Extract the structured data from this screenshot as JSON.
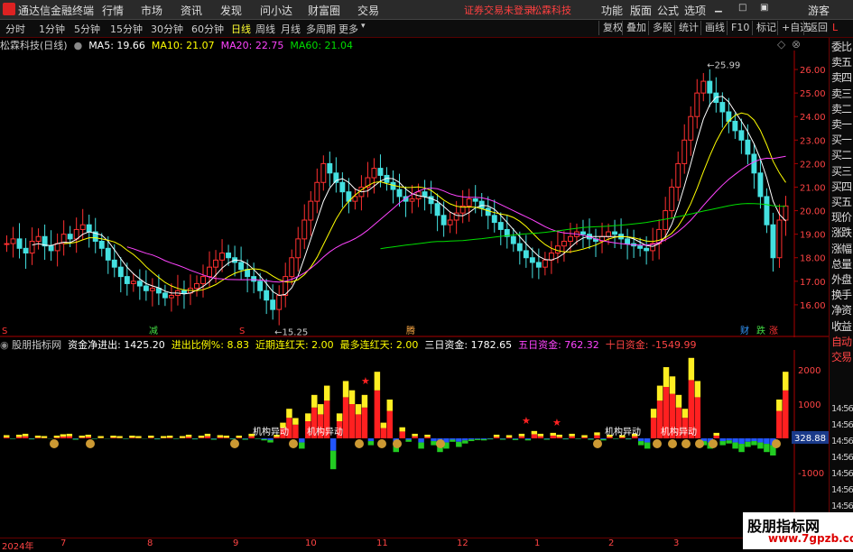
{
  "titlebar": {
    "app_title": "通达信金融终端",
    "menus": [
      "行情",
      "市场",
      "资讯",
      "发现",
      "问小达",
      "财富圈",
      "交易"
    ],
    "notice": "证券交易未登录",
    "stock_name": "松霖科技",
    "right_menus": [
      "功能",
      "版面",
      "公式",
      "选项"
    ],
    "guest": "游客"
  },
  "toolbar": {
    "periods": [
      "分时",
      "1分钟",
      "5分钟",
      "15分钟",
      "30分钟",
      "60分钟",
      "日线",
      "周线",
      "月线",
      "多周期",
      "更多"
    ],
    "active_period": "日线",
    "tools": [
      "复权",
      "叠加",
      "多股",
      "统计",
      "画线",
      "F10",
      "标记",
      "+自选",
      "返回"
    ]
  },
  "ma_legend": {
    "title": "松霖科技(日线)",
    "ma5": "MA5: 19.66",
    "ma10": "MA10: 21.07",
    "ma20": "MA20: 22.75",
    "ma60": "MA60: 21.04",
    "colors": {
      "ma5": "#ffffff",
      "ma10": "#ffff00",
      "ma20": "#ff44ff",
      "ma60": "#00dd00"
    }
  },
  "indicator_legend": {
    "name": "股朋指标网",
    "flow": "资金净进出: 1425.20",
    "ratio": "进出比例%: 8.83",
    "red_days": "近期连红天: 2.00",
    "max_red": "最多连红天: 2.00",
    "three_day": "三日资金: 1782.65",
    "five_day": "五日资金: 762.32",
    "ten_day": "十日资金: -1549.99"
  },
  "price_axis": [
    "26.00",
    "25.00",
    "24.00",
    "23.00",
    "22.00",
    "21.00",
    "20.00",
    "19.00",
    "18.00",
    "17.00",
    "16.00"
  ],
  "indicator_axis": [
    "2000",
    "1000",
    "0",
    "-1000"
  ],
  "indicator_current": "328.88",
  "annotations": {
    "high": "25.99",
    "low": "15.25",
    "markers": [
      "S",
      "减",
      "S",
      "腾",
      "财",
      "跌",
      "涨"
    ],
    "flow_label": "机构异动"
  },
  "time_axis": [
    "2024年",
    "7",
    "8",
    "9",
    "10",
    "11",
    "12",
    "1",
    "2",
    "3"
  ],
  "sidebar": [
    "委比",
    "卖五",
    "卖四",
    "卖三",
    "卖二",
    "卖一",
    "买一",
    "买二",
    "买三",
    "买四",
    "买五",
    "现价",
    "涨跌",
    "涨幅",
    "总量",
    "外盘",
    "换手",
    "净资",
    "收益",
    "自动",
    "交易"
  ],
  "sidebar_times": [
    "14:56",
    "14:56",
    "14:56",
    "14:56",
    "14:56",
    "14:56",
    "14:56",
    "14:56",
    "14:56"
  ],
  "watermark": {
    "line1": "股朋指标网",
    "line2": "www.7gpzb.com"
  },
  "chart_data": {
    "type": "candlestick",
    "ylim": [
      15,
      26.5
    ],
    "closes": [
      18.6,
      18.8,
      18.4,
      18.2,
      18.7,
      18.9,
      18.5,
      18.3,
      18.6,
      19.0,
      18.8,
      19.2,
      19.4,
      19.1,
      18.7,
      18.4,
      17.9,
      17.6,
      17.2,
      16.9,
      17.0,
      16.8,
      16.6,
      16.7,
      16.5,
      16.3,
      16.4,
      16.6,
      16.5,
      16.7,
      16.9,
      17.2,
      17.6,
      17.9,
      18.2,
      18.0,
      17.8,
      17.5,
      17.2,
      17.0,
      16.6,
      16.2,
      15.8,
      16.4,
      17.2,
      18.0,
      18.8,
      19.6,
      20.4,
      21.2,
      22.0,
      21.6,
      21.2,
      20.8,
      20.4,
      20.6,
      21.0,
      21.4,
      21.8,
      21.5,
      21.2,
      20.9,
      20.6,
      20.4,
      20.5,
      20.8,
      20.6,
      20.3,
      19.8,
      19.4,
      19.6,
      19.9,
      20.2,
      20.5,
      20.4,
      20.1,
      19.8,
      19.5,
      19.2,
      18.9,
      18.6,
      18.3,
      18.0,
      17.8,
      17.6,
      17.9,
      18.2,
      18.5,
      18.7,
      18.9,
      19.1,
      19.0,
      18.8,
      18.7,
      18.9,
      19.1,
      19.0,
      18.8,
      18.6,
      18.5,
      18.4,
      18.3,
      18.6,
      19.2,
      20.0,
      21.0,
      22.0,
      23.0,
      24.0,
      25.0,
      25.5,
      25.0,
      24.6,
      24.2,
      23.8,
      23.4,
      23.0,
      22.4,
      21.6,
      20.6,
      19.4,
      18.0,
      19.6,
      20.2
    ]
  },
  "flow_data": [
    30,
    -20,
    40,
    60,
    -30,
    20,
    10,
    -10,
    20,
    50,
    60,
    -40,
    20,
    40,
    -20,
    10,
    -10,
    20,
    10,
    -20,
    20,
    10,
    -10,
    20,
    -30,
    10,
    20,
    -20,
    10,
    40,
    -30,
    20,
    60,
    -40,
    30,
    20,
    -30,
    20,
    -40,
    60,
    -20,
    -60,
    -120,
    40,
    300,
    600,
    400,
    -300,
    500,
    900,
    700,
    1100,
    -900,
    500,
    1200,
    1000,
    700,
    900,
    -200,
    1400,
    300,
    800,
    -400,
    200,
    -100,
    60,
    -300,
    40,
    -200,
    -400,
    -300,
    -100,
    -250,
    -150,
    -80,
    -50,
    -60,
    -30,
    40,
    -40,
    30,
    -50,
    60,
    -60,
    120,
    60,
    -40,
    80,
    40,
    -30,
    60,
    -20,
    30,
    -40,
    90,
    -60,
    40,
    -20,
    30,
    -30,
    60,
    -200,
    -300,
    600,
    1100,
    1500,
    1300,
    900,
    600,
    1700,
    1200,
    -200,
    -300,
    80,
    -200,
    -150,
    -300,
    -400,
    -250,
    -200,
    -300,
    -400,
    -500,
    800,
    1400
  ]
}
